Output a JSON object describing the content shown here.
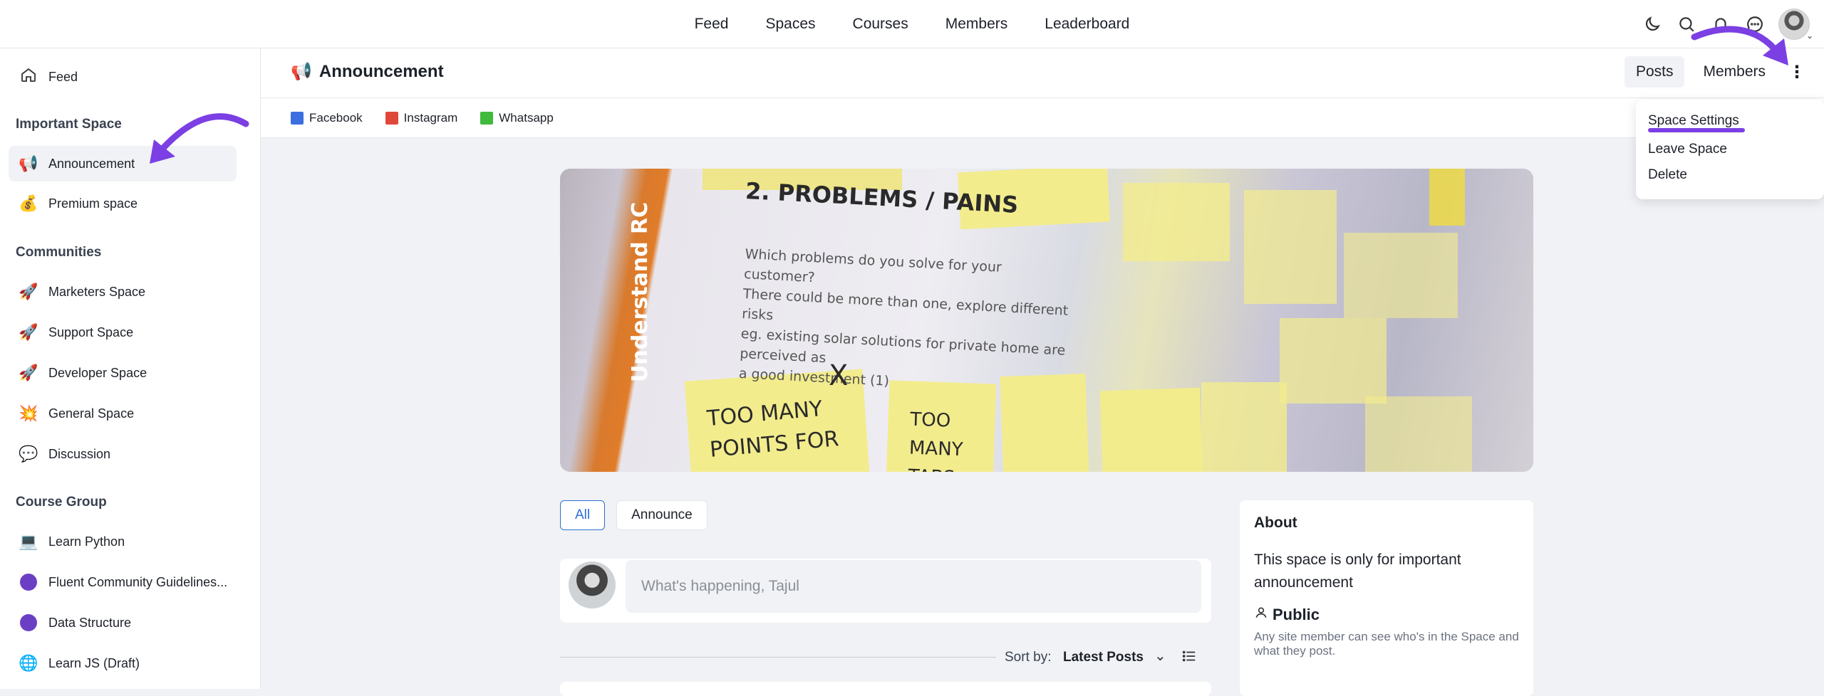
{
  "top_nav": [
    "Feed",
    "Spaces",
    "Courses",
    "Members",
    "Leaderboard"
  ],
  "top_icons": [
    "moon-icon",
    "search-icon",
    "bell-icon",
    "chat-icon",
    "user-avatar"
  ],
  "sidebar": {
    "feed": "Feed",
    "sections": [
      {
        "heading": "Important Space",
        "items": [
          {
            "label": "Announcement",
            "icon": "📢",
            "active": true
          },
          {
            "label": "Premium space",
            "icon": "💰"
          }
        ]
      },
      {
        "heading": "Communities",
        "items": [
          {
            "label": "Marketers Space",
            "icon": "🚀"
          },
          {
            "label": "Support Space",
            "icon": "🚀"
          },
          {
            "label": "Developer Space",
            "icon": "🚀"
          },
          {
            "label": "General Space",
            "icon": "💥"
          },
          {
            "label": "Discussion",
            "icon": "💬"
          }
        ]
      },
      {
        "heading": "Course Group",
        "items": [
          {
            "label": "Learn Python",
            "icon": "💻"
          },
          {
            "label": "Fluent Community Guidelines...",
            "icon": "purple-dot"
          },
          {
            "label": "Data Structure",
            "icon": "purple-dot"
          },
          {
            "label": "Learn JS (Draft)",
            "icon": "🌐"
          }
        ]
      }
    ]
  },
  "space": {
    "icon": "📢",
    "title": "Announcement",
    "tabs": [
      "Posts",
      "Members"
    ],
    "links": [
      {
        "label": "Facebook",
        "color": "#3b6fe0"
      },
      {
        "label": "Instagram",
        "color": "#e0473b"
      },
      {
        "label": "Whatsapp",
        "color": "#3fba3c"
      }
    ]
  },
  "menu": {
    "items": [
      "Space Settings",
      "Leave Space",
      "Delete"
    ]
  },
  "cover": {
    "heading": "2. PROBLEMS / PAINS",
    "side_text": "Understand RC",
    "body_lines": [
      "Which problems do you solve for your customer?",
      "There could be more than one, explore different risks",
      "eg. existing solar solutions for private home are perceived as",
      "a good investment (1)"
    ],
    "note1": "TOO MANY POINTS FOR",
    "note2": "TOO MANY TABS",
    "mark": "X"
  },
  "filters": [
    "All",
    "Announce"
  ],
  "composer": {
    "placeholder": "What's happening, Tajul"
  },
  "sort": {
    "label": "Sort by:",
    "value": "Latest Posts"
  },
  "about": {
    "title": "About",
    "description": "This space is only for important announcement",
    "privacy": "Public",
    "privacy_desc": "Any site member can see who's in the Space and what they post."
  },
  "colors": {
    "accent": "#2a6fd6",
    "annotation": "#7b3fe4"
  }
}
